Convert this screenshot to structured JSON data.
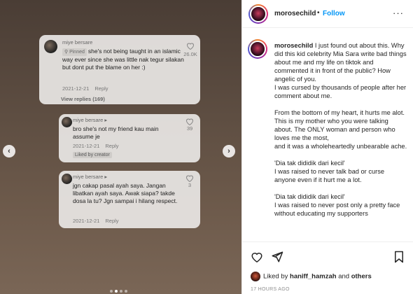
{
  "media": {
    "comments": [
      {
        "user": "miye bersare",
        "pinned_label": "Pinned",
        "text": "she's not being taught in an islamic way ever since she was little nak tegur silakan but dont put the blame on her :)",
        "date": "2021-12-21",
        "reply_label": "Reply",
        "likes": "26.0K",
        "view_replies": "View replies (169)"
      },
      {
        "user": "miye bersare ▸",
        "text": "bro she's not my friend kau main assume je",
        "date": "2021-12-21",
        "reply_label": "Reply",
        "likes": "39",
        "liked_by_creator": "Liked by creator"
      },
      {
        "user": "miye bersare ▸",
        "text": "jgn cakap pasal ayah saya. Jangan libatkan ayah saya. Awak siapa? takde dosa la tu? Jgn sampai i hilang respect.",
        "date": "2021-12-21",
        "reply_label": "Reply",
        "likes": "3"
      }
    ],
    "prev_arrow": "‹",
    "next_arrow": "›"
  },
  "header": {
    "username": "morosechild",
    "separator": "•",
    "follow_label": "Follow",
    "more": "···"
  },
  "caption": {
    "username": "morosechild",
    "p1": "I just found out about this. Why did this kid celebrity Mia Sara write bad things about me and my life on tiktok and commented it in front of the public? How angelic of you.",
    "p2": "I was cursed by thousands of people after her comment about me.",
    "p3": "From the bottom of my heart, it hurts me alot. This is my mother who you were talking about. The ONLY woman and person who loves me the most,",
    "p4": "and it was a wholeheartedly unbearable ache.",
    "p5": "'Dia tak dididik dari kecil'",
    "p6": "I was raised to never talk bad or curse anyone even if it hurt me a lot.",
    "p7": "'Dia tak dididik dari kecil'",
    "p8": "I was raised to never post only a pretty face without educating my supporters"
  },
  "likes": {
    "prefix": "Liked by",
    "user": "haniff_hamzah",
    "conj": "and",
    "others": "others"
  },
  "timestamp": "17 HOURS AGO",
  "icons": {
    "heart": "heart-icon",
    "share": "share-icon",
    "save": "bookmark-icon"
  }
}
